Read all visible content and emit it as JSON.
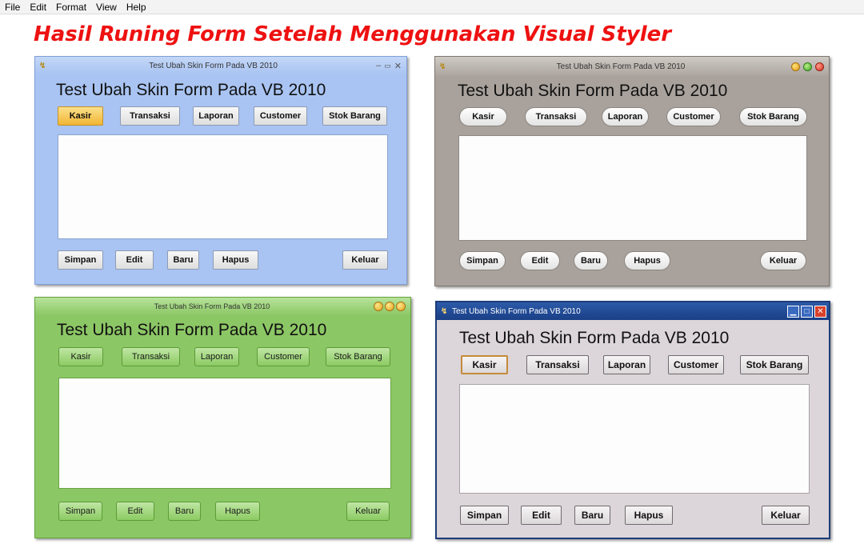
{
  "menu": [
    "File",
    "Edit",
    "Format",
    "View",
    "Help"
  ],
  "headline": "Hasil Runing Form Setelah Menggunakan Visual Styler",
  "window_caption": "Test Ubah Skin Form Pada VB 2010",
  "form_title": "Test Ubah Skin Form Pada VB 2010",
  "top_buttons": [
    "Kasir",
    "Transaksi",
    "Laporan",
    "Customer",
    "Stok Barang"
  ],
  "bottom_buttons": [
    "Simpan",
    "Edit",
    "Baru",
    "Hapus",
    "Keluar"
  ],
  "icons": {
    "app": "vb-app-icon",
    "minimize": "minimize-icon",
    "maximize": "maximize-icon",
    "close": "close-icon"
  },
  "colors": {
    "headline": "#ee1111",
    "skin_blue": "#a9c4f2",
    "skin_gray": "#a9a29c",
    "skin_green": "#8cc765",
    "skin_classic": "#dcd5d9"
  }
}
